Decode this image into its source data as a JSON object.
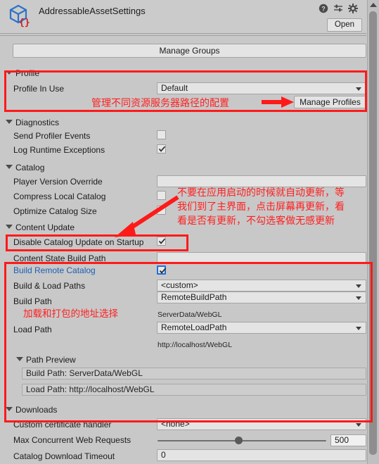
{
  "header": {
    "title": "AddressableAssetSettings",
    "open_label": "Open",
    "icons": [
      "help-icon",
      "preset-icon",
      "gear-icon"
    ]
  },
  "manage_groups_label": "Manage Groups",
  "sections": {
    "profile": {
      "title": "Profile",
      "profile_in_use_label": "Profile In Use",
      "profile_in_use_value": "Default",
      "manage_profiles_label": "Manage Profiles"
    },
    "diagnostics": {
      "title": "Diagnostics",
      "send_profiler_events_label": "Send Profiler Events",
      "log_runtime_exceptions_label": "Log Runtime Exceptions"
    },
    "catalog": {
      "title": "Catalog",
      "player_version_override_label": "Player Version Override",
      "player_version_override_value": "",
      "compress_local_catalog_label": "Compress Local Catalog",
      "optimize_catalog_size_label": "Optimize Catalog Size"
    },
    "content_update": {
      "title": "Content Update",
      "disable_catalog_update_label": "Disable Catalog Update on Startup",
      "content_state_build_path_label": "Content State Build Path",
      "content_state_build_path_value": "",
      "build_remote_catalog_label": "Build Remote Catalog",
      "build_load_paths_label": "Build & Load Paths",
      "build_load_paths_value": "<custom>",
      "build_path_label": "Build Path",
      "build_path_value": "RemoteBuildPath",
      "build_path_preview_inline": "ServerData/WebGL",
      "load_path_label": "Load Path",
      "load_path_value": "RemoteLoadPath",
      "load_path_preview_inline": "http://localhost/WebGL",
      "path_preview_title": "Path Preview",
      "path_preview_build": "Build Path: ServerData/WebGL",
      "path_preview_load": "Load Path: http://localhost/WebGL"
    },
    "downloads": {
      "title": "Downloads",
      "custom_certificate_handler_label": "Custom certificate handler",
      "custom_certificate_handler_value": "<none>",
      "max_concurrent_web_requests_label": "Max Concurrent Web Requests",
      "max_concurrent_web_requests_value": "500",
      "max_concurrent_slider_percent": 48,
      "catalog_download_timeout_label": "Catalog Download Timeout",
      "catalog_download_timeout_value": "0"
    }
  },
  "annotations": {
    "profile_note": "管理不同资源服务器路径的配置",
    "catalog_note_line1": "不要在应用启动的时候就自动更新，等",
    "catalog_note_line2": "我们到了主界面，点击屏幕再更新，看",
    "catalog_note_line3": "看是否有更新，不勾选客做无感更新",
    "paths_note": "加载和打包的地址选择"
  },
  "colors": {
    "panel_bg": "#c8c8c8",
    "field_bg": "#e4e4e4",
    "annotation_red": "#ff1f1f",
    "modified_blue": "#1c5fb4"
  }
}
